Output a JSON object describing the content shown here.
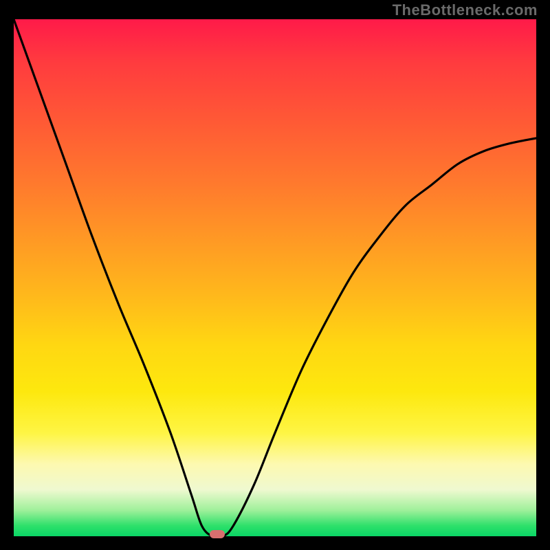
{
  "watermark": {
    "text": "TheBottleneck.com"
  },
  "colors": {
    "curve_stroke": "#000000",
    "marker_fill": "#d96f6f",
    "frame_bg": "#000000"
  },
  "chart_data": {
    "type": "line",
    "title": "",
    "xlabel": "",
    "ylabel": "",
    "xlim": [
      0,
      100
    ],
    "ylim": [
      0,
      100
    ],
    "grid": false,
    "legend": false,
    "series": [
      {
        "name": "bottleneck_curve",
        "x": [
          0,
          5,
          10,
          15,
          20,
          25,
          30,
          34,
          36,
          38,
          40,
          42,
          46,
          50,
          55,
          60,
          65,
          70,
          75,
          80,
          85,
          90,
          95,
          100
        ],
        "y": [
          100,
          86,
          72,
          58,
          45,
          33,
          20,
          8,
          2,
          0,
          0,
          2,
          10,
          20,
          32,
          42,
          51,
          58,
          64,
          68,
          72,
          74.5,
          76,
          77
        ]
      }
    ],
    "marker": {
      "x": 39,
      "y": 0
    },
    "gradient_note": "background encodes bottleneck severity (green=good at bottom to red=bad at top)"
  }
}
